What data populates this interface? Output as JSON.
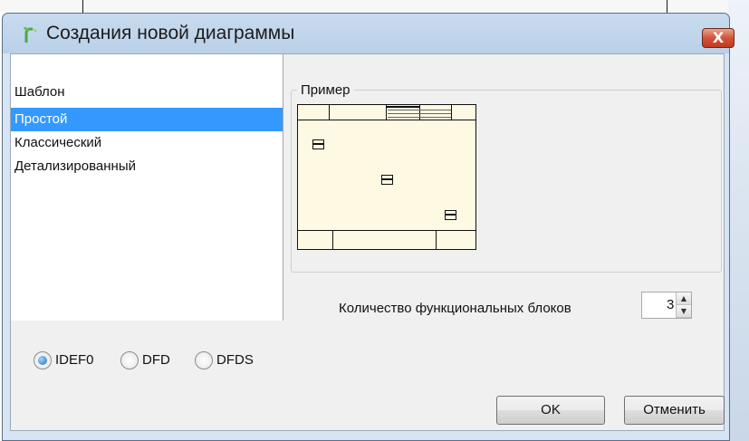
{
  "window": {
    "title": "Создания новой диаграммы",
    "app_icon": "app-logo-icon",
    "close_icon": "close-icon",
    "close_label": "X"
  },
  "templates": {
    "label": "Шаблон",
    "items": [
      "Простой",
      "Классический",
      "Детализированный"
    ],
    "selected": "Простой"
  },
  "example": {
    "label": "Пример"
  },
  "blocks": {
    "label": "Количество функциональных блоков",
    "value": "3"
  },
  "notation": {
    "options": [
      "IDEF0",
      "DFD",
      "DFDS"
    ],
    "selected": "IDEF0"
  },
  "buttons": {
    "ok": "OK",
    "cancel": "Отменить"
  },
  "colors": {
    "selection": "#3399ff",
    "close_button": "#c9452b",
    "preview_background": "#fdf9e2"
  }
}
